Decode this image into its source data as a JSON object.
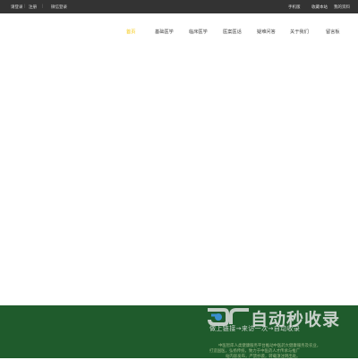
{
  "topbar": {
    "login": "请登录",
    "register": "注册",
    "wechat": "微信登录",
    "mobile": "手机版",
    "favorite": "收藏本站",
    "profile": "我的资料"
  },
  "nav": {
    "items": [
      {
        "label": "首页",
        "active": true
      },
      {
        "label": "基础医学",
        "active": false
      },
      {
        "label": "临床医学",
        "active": false
      },
      {
        "label": "医案医话",
        "active": false
      },
      {
        "label": "疑难问答",
        "active": false
      },
      {
        "label": "关于我们",
        "active": false
      },
      {
        "label": "留言板",
        "active": false
      }
    ]
  },
  "footer": {
    "line1": "中医智库人类健康服务平台推动中医药大健康服务及农业，",
    "line2": "打造国医，弘扬传统，致力于中医药人才传承与推广",
    "line3": "站内容发布，严禁抄袭，转载须注明出处。"
  },
  "watermark": {
    "title": "自动秒收录",
    "subtitle": "做上链接→来访一次→自动收录"
  }
}
